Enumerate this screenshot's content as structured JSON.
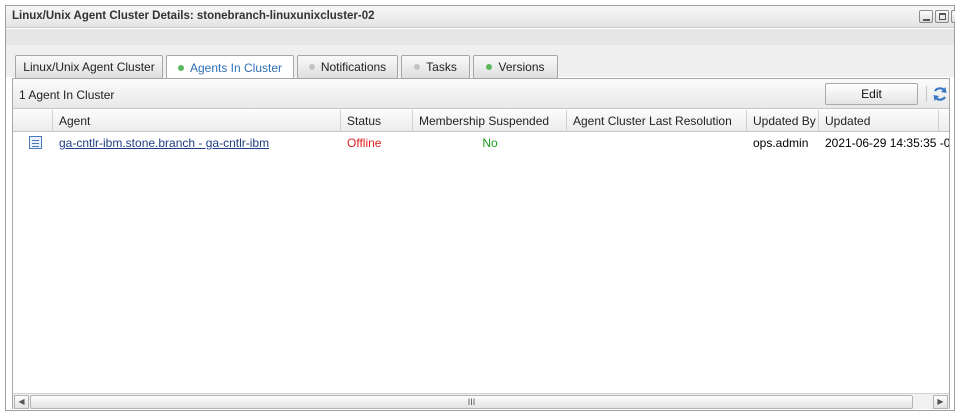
{
  "window": {
    "title": "Linux/Unix Agent Cluster Details: stonebranch-linuxunixcluster-02"
  },
  "tabs": [
    {
      "label": "Linux/Unix Agent Cluster",
      "dot": ""
    },
    {
      "label": "Agents In Cluster",
      "dot": "green"
    },
    {
      "label": "Notifications",
      "dot": "grey"
    },
    {
      "label": "Tasks",
      "dot": "grey"
    },
    {
      "label": "Versions",
      "dot": "green"
    }
  ],
  "toolbar": {
    "count_text": "1 Agent In Cluster",
    "edit_label": "Edit",
    "refresh_icon": "refresh-icon"
  },
  "table": {
    "columns": [
      "Agent",
      "Status",
      "Membership Suspended",
      "Agent Cluster Last Resolution",
      "Updated By",
      "Updated"
    ],
    "rows": [
      {
        "agent": "ga-cntlr-ibm.stone.branch - ga-cntlr-ibm",
        "status": "Offline",
        "membership_suspended": "No",
        "last_resolution": "",
        "updated_by": "ops.admin",
        "updated": "2021-06-29 14:35:35 -0"
      }
    ]
  },
  "scrollbar": {
    "thumb_grip": "III"
  },
  "colors": {
    "active_tab": "#2f6fb5",
    "offline": "#e02020",
    "no": "#1c9a1c",
    "dot_green": "#5cb85c",
    "link": "#1f3e86"
  }
}
